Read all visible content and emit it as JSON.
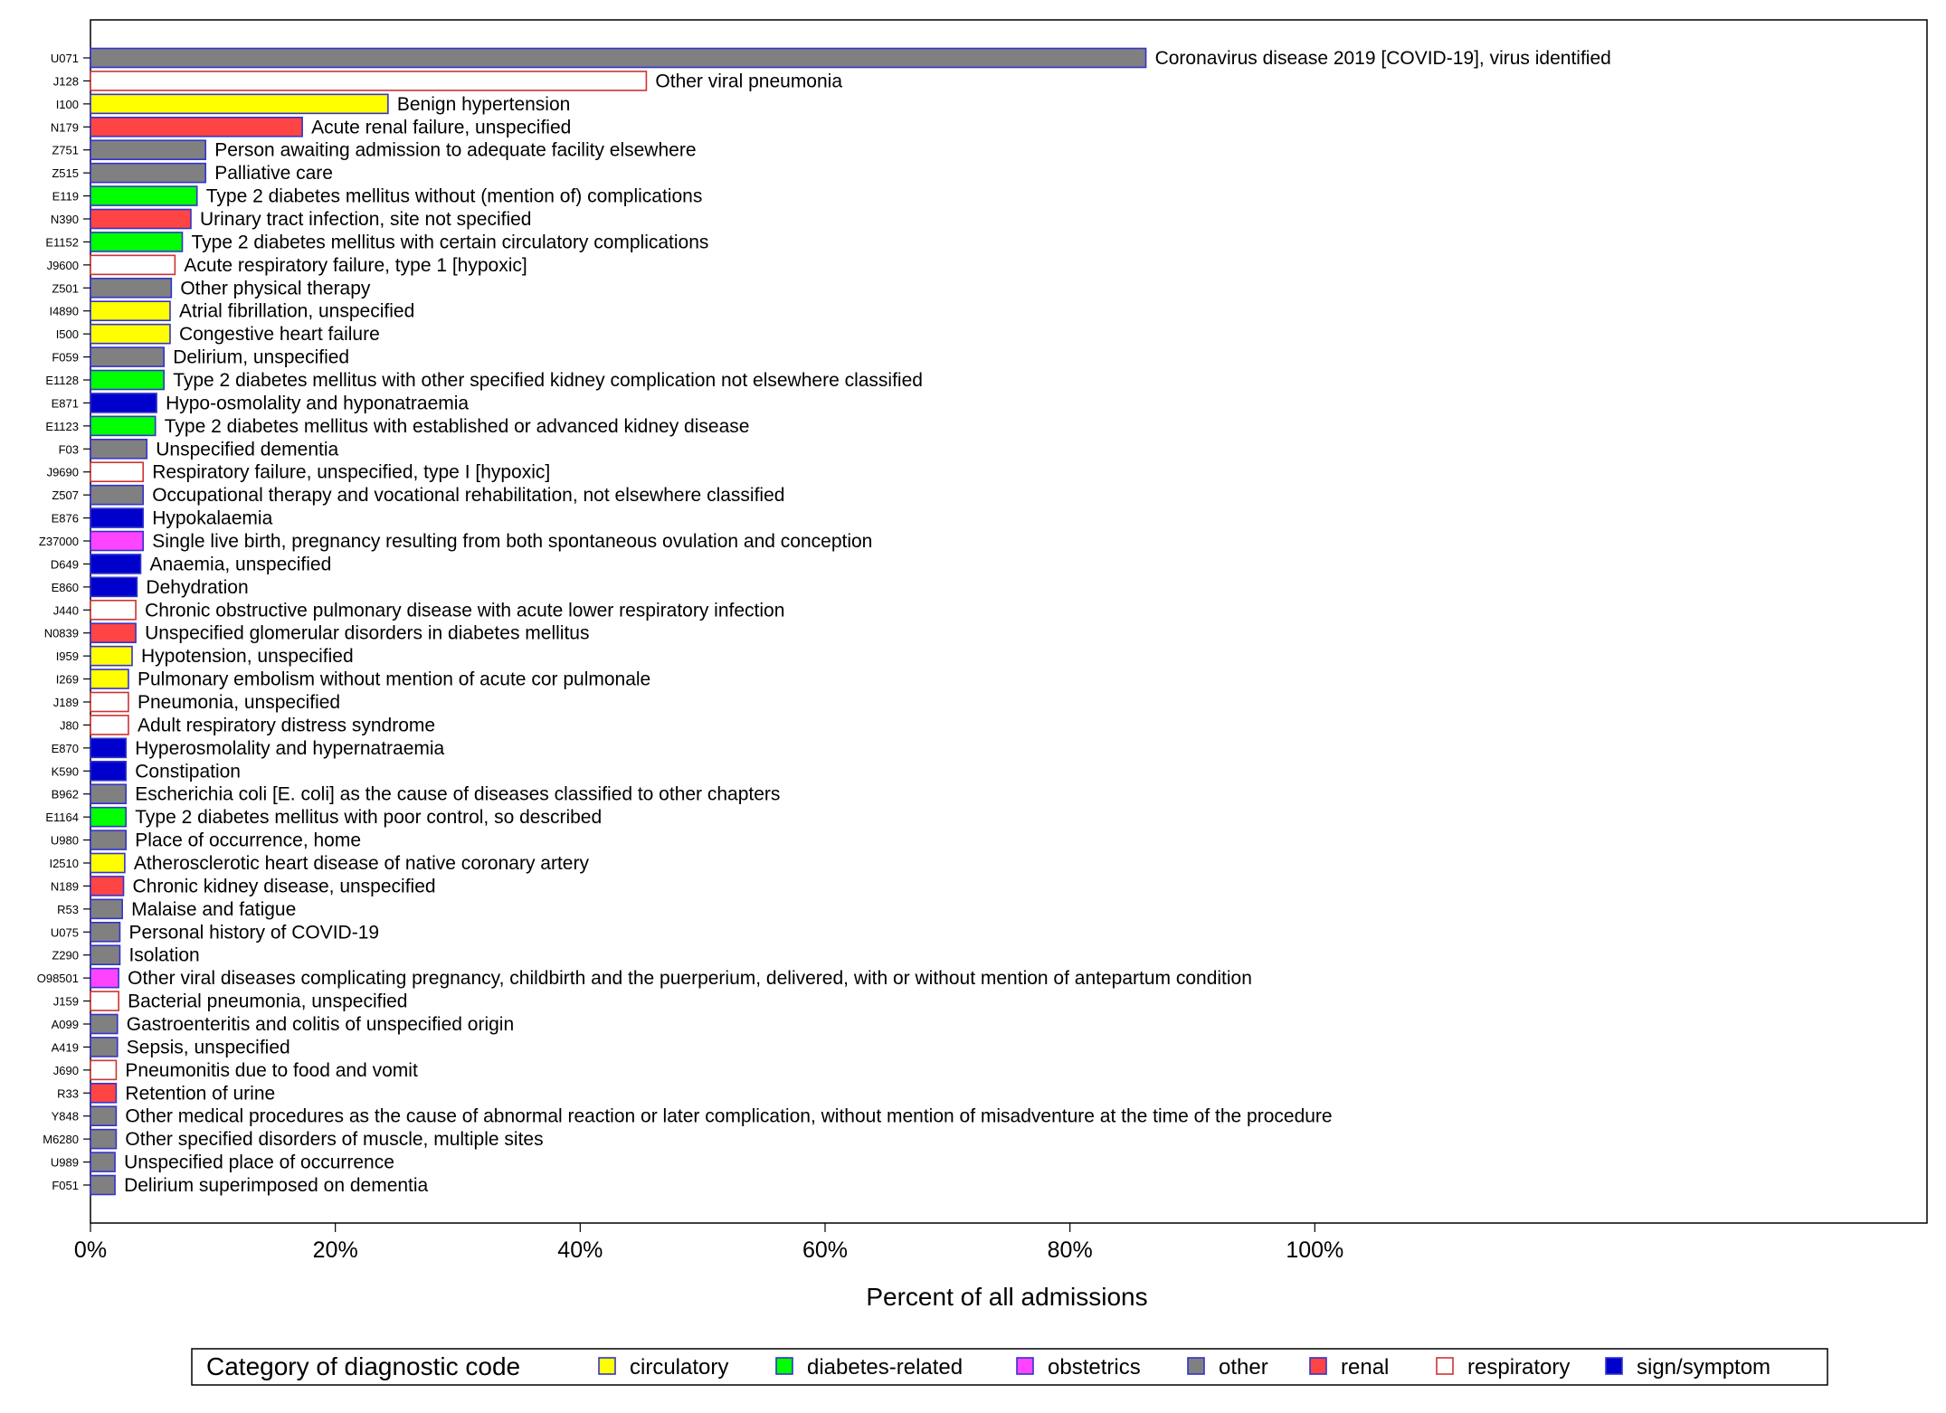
{
  "chart_data": {
    "type": "bar",
    "orientation": "horizontal",
    "xlabel": "Percent of all admissions",
    "ylabel": "",
    "xlim": [
      0,
      150
    ],
    "x_ticks": [
      0,
      20,
      40,
      60,
      80,
      100
    ],
    "x_tick_labels": [
      "0%",
      "20%",
      "40%",
      "60%",
      "80%",
      "100%"
    ],
    "grid": false,
    "legend": {
      "title": "Category of diagnostic code",
      "position": "bottom",
      "entries": [
        {
          "name": "circulatory",
          "fill": "#ffff00",
          "stroke": "#3333cc"
        },
        {
          "name": "diabetes-related",
          "fill": "#00ff00",
          "stroke": "#3333cc"
        },
        {
          "name": "obstetrics",
          "fill": "#ff44ff",
          "stroke": "#3333cc"
        },
        {
          "name": "other",
          "fill": "#808080",
          "stroke": "#3333cc"
        },
        {
          "name": "renal",
          "fill": "#ff4444",
          "stroke": "#3333cc"
        },
        {
          "name": "respiratory",
          "fill": "#ffffff",
          "stroke": "#cc3333"
        },
        {
          "name": "sign/symptom",
          "fill": "#0000cc",
          "stroke": "#3333cc"
        }
      ]
    },
    "bars": [
      {
        "code": "U071",
        "label": "Coronavirus disease 2019 [COVID-19], virus identified",
        "category": "other",
        "value": 86.2
      },
      {
        "code": "J128",
        "label": "Other viral pneumonia",
        "category": "respiratory",
        "value": 45.4
      },
      {
        "code": "I100",
        "label": "Benign hypertension",
        "category": "circulatory",
        "value": 24.3
      },
      {
        "code": "N179",
        "label": "Acute renal failure, unspecified",
        "category": "renal",
        "value": 17.3
      },
      {
        "code": "Z751",
        "label": "Person awaiting admission to adequate facility elsewhere",
        "category": "other",
        "value": 9.4
      },
      {
        "code": "Z515",
        "label": "Palliative care",
        "category": "other",
        "value": 9.4
      },
      {
        "code": "E119",
        "label": "Type 2 diabetes mellitus without (mention of) complications",
        "category": "diabetes-related",
        "value": 8.7
      },
      {
        "code": "N390",
        "label": "Urinary tract infection, site not specified",
        "category": "renal",
        "value": 8.2
      },
      {
        "code": "E1152",
        "label": "Type 2 diabetes mellitus with certain circulatory complications",
        "category": "diabetes-related",
        "value": 7.5
      },
      {
        "code": "J9600",
        "label": "Acute respiratory failure, type 1 [hypoxic]",
        "category": "respiratory",
        "value": 6.9
      },
      {
        "code": "Z501",
        "label": "Other physical therapy",
        "category": "other",
        "value": 6.6
      },
      {
        "code": "I4890",
        "label": "Atrial fibrillation, unspecified",
        "category": "circulatory",
        "value": 6.5
      },
      {
        "code": "I500",
        "label": "Congestive heart failure",
        "category": "circulatory",
        "value": 6.5
      },
      {
        "code": "F059",
        "label": "Delirium, unspecified",
        "category": "other",
        "value": 6.0
      },
      {
        "code": "E1128",
        "label": "Type 2 diabetes mellitus with other specified kidney complication not elsewhere classified",
        "category": "diabetes-related",
        "value": 6.0
      },
      {
        "code": "E871",
        "label": "Hypo-osmolality and hyponatraemia",
        "category": "sign/symptom",
        "value": 5.4
      },
      {
        "code": "E1123",
        "label": "Type 2 diabetes mellitus with established or advanced kidney disease",
        "category": "diabetes-related",
        "value": 5.3
      },
      {
        "code": "F03",
        "label": "Unspecified dementia",
        "category": "other",
        "value": 4.6
      },
      {
        "code": "J9690",
        "label": "Respiratory failure, unspecified, type I [hypoxic]",
        "category": "respiratory",
        "value": 4.3
      },
      {
        "code": "Z507",
        "label": "Occupational therapy and vocational rehabilitation, not elsewhere classified",
        "category": "other",
        "value": 4.3
      },
      {
        "code": "E876",
        "label": "Hypokalaemia",
        "category": "sign/symptom",
        "value": 4.3
      },
      {
        "code": "Z37000",
        "label": "Single live birth, pregnancy resulting from both spontaneous ovulation and conception",
        "category": "obstetrics",
        "value": 4.3
      },
      {
        "code": "D649",
        "label": "Anaemia, unspecified",
        "category": "sign/symptom",
        "value": 4.1
      },
      {
        "code": "E860",
        "label": "Dehydration",
        "category": "sign/symptom",
        "value": 3.8
      },
      {
        "code": "J440",
        "label": "Chronic obstructive pulmonary disease with acute lower respiratory infection",
        "category": "respiratory",
        "value": 3.7
      },
      {
        "code": "N0839",
        "label": "Unspecified glomerular disorders in diabetes mellitus",
        "category": "renal",
        "value": 3.7
      },
      {
        "code": "I959",
        "label": "Hypotension, unspecified",
        "category": "circulatory",
        "value": 3.4
      },
      {
        "code": "I269",
        "label": "Pulmonary embolism without mention of acute cor pulmonale",
        "category": "circulatory",
        "value": 3.1
      },
      {
        "code": "J189",
        "label": "Pneumonia, unspecified",
        "category": "respiratory",
        "value": 3.1
      },
      {
        "code": "J80",
        "label": "Adult respiratory distress syndrome",
        "category": "respiratory",
        "value": 3.1
      },
      {
        "code": "E870",
        "label": "Hyperosmolality and hypernatraemia",
        "category": "sign/symptom",
        "value": 2.9
      },
      {
        "code": "K590",
        "label": "Constipation",
        "category": "sign/symptom",
        "value": 2.9
      },
      {
        "code": "B962",
        "label": "Escherichia coli [E. coli] as the cause of diseases classified to other chapters",
        "category": "other",
        "value": 2.9
      },
      {
        "code": "E1164",
        "label": "Type 2 diabetes mellitus with poor control, so described",
        "category": "diabetes-related",
        "value": 2.9
      },
      {
        "code": "U980",
        "label": "Place of occurrence, home",
        "category": "other",
        "value": 2.9
      },
      {
        "code": "I2510",
        "label": "Atherosclerotic heart disease of native coronary artery",
        "category": "circulatory",
        "value": 2.8
      },
      {
        "code": "N189",
        "label": "Chronic kidney disease, unspecified",
        "category": "renal",
        "value": 2.7
      },
      {
        "code": "R53",
        "label": "Malaise and fatigue",
        "category": "other",
        "value": 2.6
      },
      {
        "code": "U075",
        "label": "Personal history of COVID-19",
        "category": "other",
        "value": 2.4
      },
      {
        "code": "Z290",
        "label": "Isolation",
        "category": "other",
        "value": 2.4
      },
      {
        "code": "O98501",
        "label": "Other viral diseases complicating pregnancy, childbirth and the puerperium, delivered, with or without mention of antepartum condition",
        "category": "obstetrics",
        "value": 2.3
      },
      {
        "code": "J159",
        "label": "Bacterial pneumonia, unspecified",
        "category": "respiratory",
        "value": 2.3
      },
      {
        "code": "A099",
        "label": "Gastroenteritis and colitis of unspecified origin",
        "category": "other",
        "value": 2.2
      },
      {
        "code": "A419",
        "label": "Sepsis, unspecified",
        "category": "other",
        "value": 2.2
      },
      {
        "code": "J690",
        "label": "Pneumonitis due to food and vomit",
        "category": "respiratory",
        "value": 2.1
      },
      {
        "code": "R33",
        "label": "Retention of urine",
        "category": "renal",
        "value": 2.1
      },
      {
        "code": "Y848",
        "label": "Other medical procedures as the cause of abnormal reaction or later complication, without mention of misadventure at the time of the procedure",
        "category": "other",
        "value": 2.1
      },
      {
        "code": "M6280",
        "label": "Other specified disorders of muscle, multiple sites",
        "category": "other",
        "value": 2.1
      },
      {
        "code": "U989",
        "label": "Unspecified place of occurrence",
        "category": "other",
        "value": 2.0
      },
      {
        "code": "F051",
        "label": "Delirium superimposed on dementia",
        "category": "other",
        "value": 2.0
      }
    ]
  }
}
